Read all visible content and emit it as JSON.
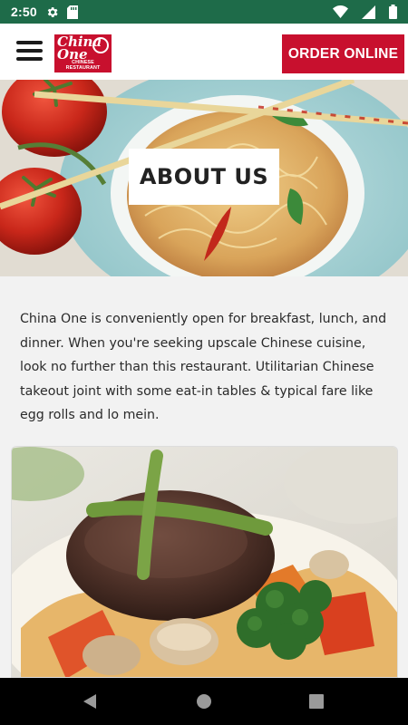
{
  "status_bar": {
    "time": "2:50",
    "icons": [
      "gear-icon",
      "sd-card-icon",
      "wifi-icon",
      "cell-signal-icon",
      "battery-icon"
    ],
    "background": "#1e6b49"
  },
  "header": {
    "logo": {
      "line1": "China",
      "line2": "One",
      "tagline": "CHINESE RESTAURANT"
    },
    "order_button": "ORDER ONLINE",
    "accent_color": "#c8102e"
  },
  "hero": {
    "title": "ABOUT US"
  },
  "main": {
    "description": "China One is conveniently open for breakfast, lunch, and dinner. When you're seeking upscale Chinese cuisine, look no further than this restaurant. Utilitarian Chinese takeout joint with some eat-in tables & typical fare like egg rolls and lo mein."
  },
  "nav_bar": {
    "buttons": [
      "back-icon",
      "home-icon",
      "recents-icon"
    ]
  }
}
